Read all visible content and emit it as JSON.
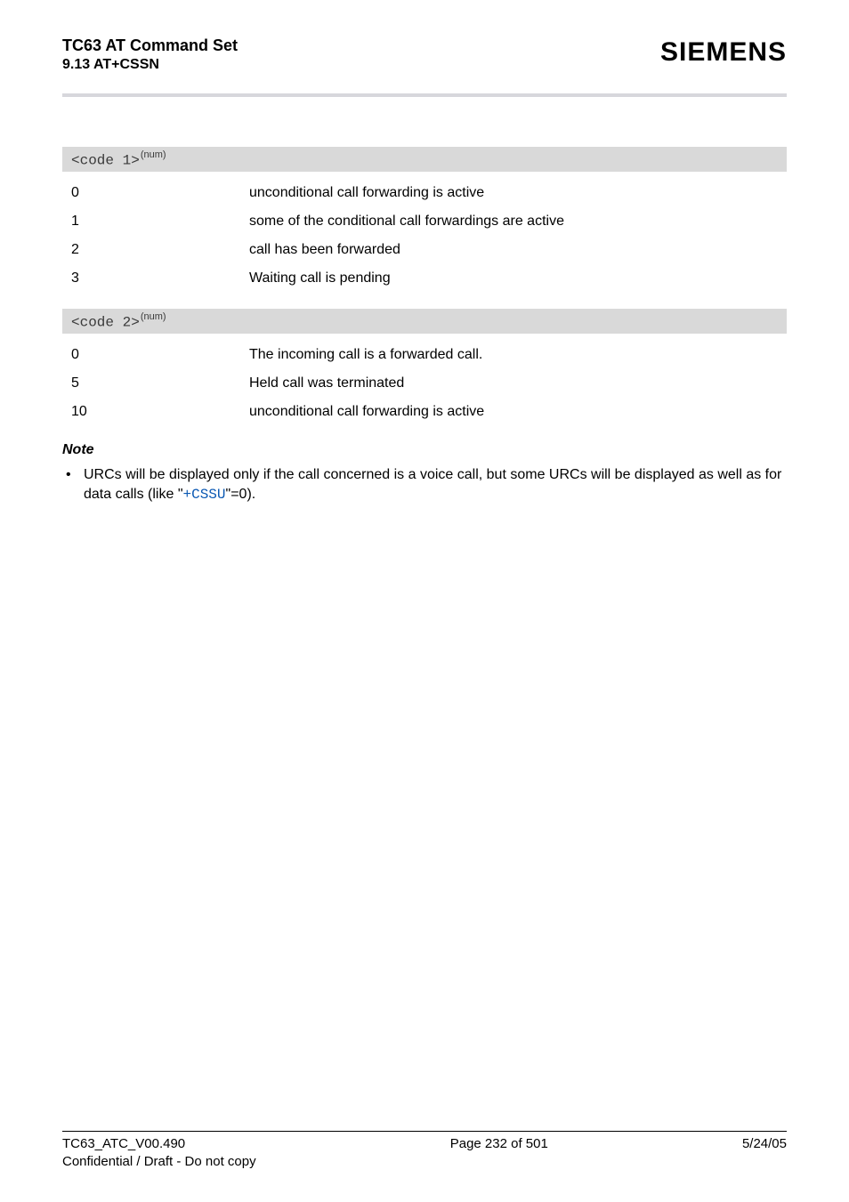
{
  "header": {
    "title": "TC63 AT Command Set",
    "section": "9.13 AT+CSSN",
    "brand": "SIEMENS"
  },
  "params": [
    {
      "name": "<code 1>",
      "sup": "(num)",
      "rows": [
        {
          "key": "0",
          "desc": "unconditional call forwarding is active"
        },
        {
          "key": "1",
          "desc": "some of the conditional call forwardings are active"
        },
        {
          "key": "2",
          "desc": "call has been forwarded"
        },
        {
          "key": "3",
          "desc": "Waiting call is pending"
        }
      ]
    },
    {
      "name": "<code 2>",
      "sup": "(num)",
      "rows": [
        {
          "key": "0",
          "desc": "The incoming call is a forwarded call."
        },
        {
          "key": "5",
          "desc": "Held call was terminated"
        },
        {
          "key": "10",
          "desc": "unconditional call forwarding is active"
        }
      ]
    }
  ],
  "note": {
    "heading": "Note",
    "item_pre": "URCs will be displayed only if the call concerned is a voice call, but some URCs will be displayed as well as for data calls (like \"",
    "item_link": "+CSSU",
    "item_post": "\"=0)."
  },
  "footer": {
    "version": "TC63_ATC_V00.490",
    "confidential": "Confidential / Draft - Do not copy",
    "page": "Page 232 of 501",
    "date": "5/24/05"
  }
}
